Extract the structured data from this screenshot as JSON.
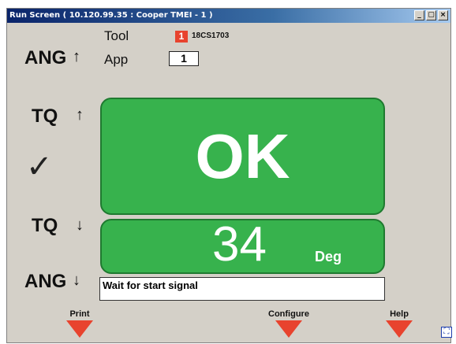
{
  "window": {
    "title": "Run Screen  ( 10.120.99.35 : Cooper TMEI - 1 )",
    "controls": {
      "minimize": "_",
      "restore": "▢",
      "close": "×"
    }
  },
  "header": {
    "tool_label": "Tool",
    "tool_id": "1",
    "tool_serial": "18CS1703",
    "app_label": "App",
    "app_value": "1"
  },
  "indicators": {
    "ang_high": {
      "label": "ANG",
      "arrow": "↑"
    },
    "tq_high": {
      "label": "TQ",
      "arrow": "↑"
    },
    "check": "✓",
    "tq_low": {
      "label": "TQ",
      "arrow": "↓"
    },
    "ang_low": {
      "label": "ANG",
      "arrow": "↓"
    }
  },
  "result": {
    "status": "OK",
    "value": "34",
    "unit": "Deg",
    "status_color": "#37b24d"
  },
  "message": "Wait for start signal",
  "function_keys": [
    {
      "label": "Print"
    },
    {
      "label": "Configure"
    },
    {
      "label": "Help"
    }
  ],
  "colors": {
    "accent": "#e8432e",
    "panel_green": "#37b24d"
  }
}
